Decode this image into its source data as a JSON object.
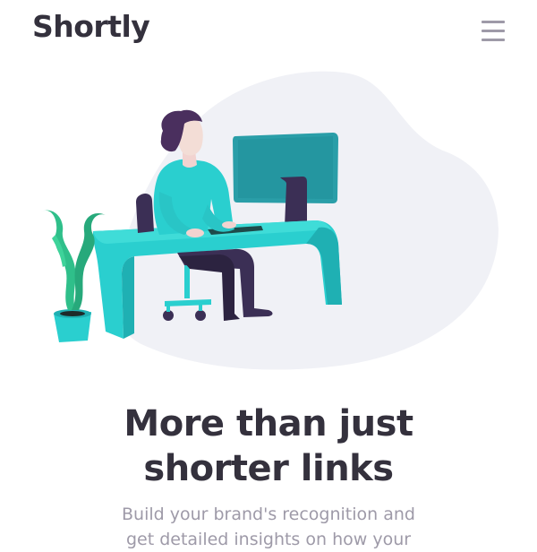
{
  "header": {
    "logo": "Shortly",
    "menu_icon": "hamburger-menu-icon"
  },
  "hero": {
    "illustration": "person-working-at-desk-illustration",
    "headline_line1": "More than just",
    "headline_line2": "shorter links",
    "subtitle_line1": "Build your brand's recognition and",
    "subtitle_line2": "get detailed insights on how your"
  },
  "colors": {
    "dark": "#34313d",
    "gray": "#9e9aa8",
    "cyan": "#2acfcf",
    "blob": "#f0f1f6"
  }
}
